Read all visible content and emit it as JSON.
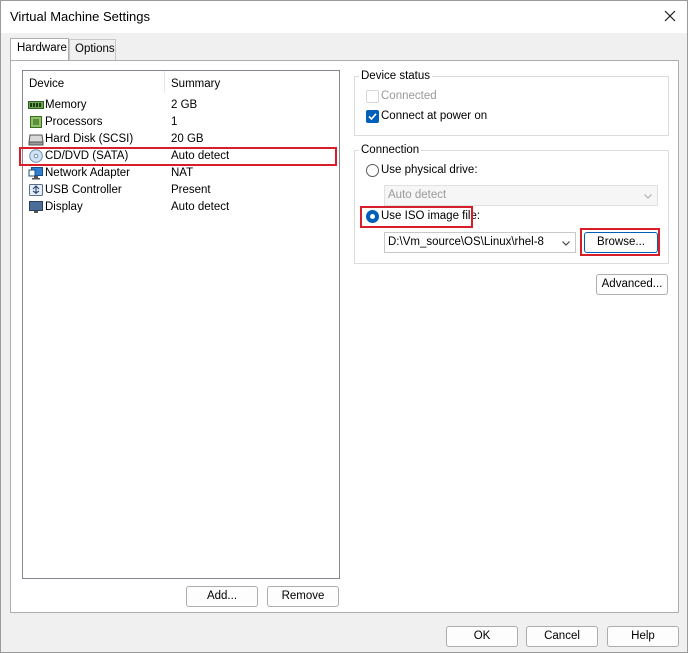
{
  "window": {
    "title": "Virtual Machine Settings"
  },
  "tabs": [
    {
      "label": "Hardware"
    },
    {
      "label": "Options"
    }
  ],
  "device_list": {
    "columns": {
      "device": "Device",
      "summary": "Summary"
    },
    "rows": [
      {
        "device": "Memory",
        "summary": "2 GB",
        "icon": "memory-icon"
      },
      {
        "device": "Processors",
        "summary": "1",
        "icon": "processor-icon"
      },
      {
        "device": "Hard Disk (SCSI)",
        "summary": "20 GB",
        "icon": "hard-disk-icon"
      },
      {
        "device": "CD/DVD (SATA)",
        "summary": "Auto detect",
        "icon": "cd-dvd-icon"
      },
      {
        "device": "Network Adapter",
        "summary": "NAT",
        "icon": "network-adapter-icon"
      },
      {
        "device": "USB Controller",
        "summary": "Present",
        "icon": "usb-icon"
      },
      {
        "device": "Display",
        "summary": "Auto detect",
        "icon": "display-icon"
      }
    ],
    "selected_index": 3
  },
  "list_buttons": {
    "add": "Add...",
    "remove": "Remove"
  },
  "device_status": {
    "title": "Device status",
    "connected": {
      "label": "Connected",
      "checked": false,
      "enabled": false
    },
    "connect_at_power_on": {
      "label": "Connect at power on",
      "checked": true
    }
  },
  "connection": {
    "title": "Connection",
    "physical_drive": {
      "label": "Use physical drive:",
      "selected": false,
      "value": "Auto detect"
    },
    "iso_image": {
      "label": "Use ISO image file:",
      "selected": true,
      "value": "D:\\Vm_source\\OS\\Linux\\rhel-8"
    },
    "browse": "Browse..."
  },
  "advanced_button": "Advanced...",
  "footer": {
    "ok": "OK",
    "cancel": "Cancel",
    "help": "Help"
  },
  "colors": {
    "accent": "#005fb8",
    "highlight": "#d81e28"
  }
}
